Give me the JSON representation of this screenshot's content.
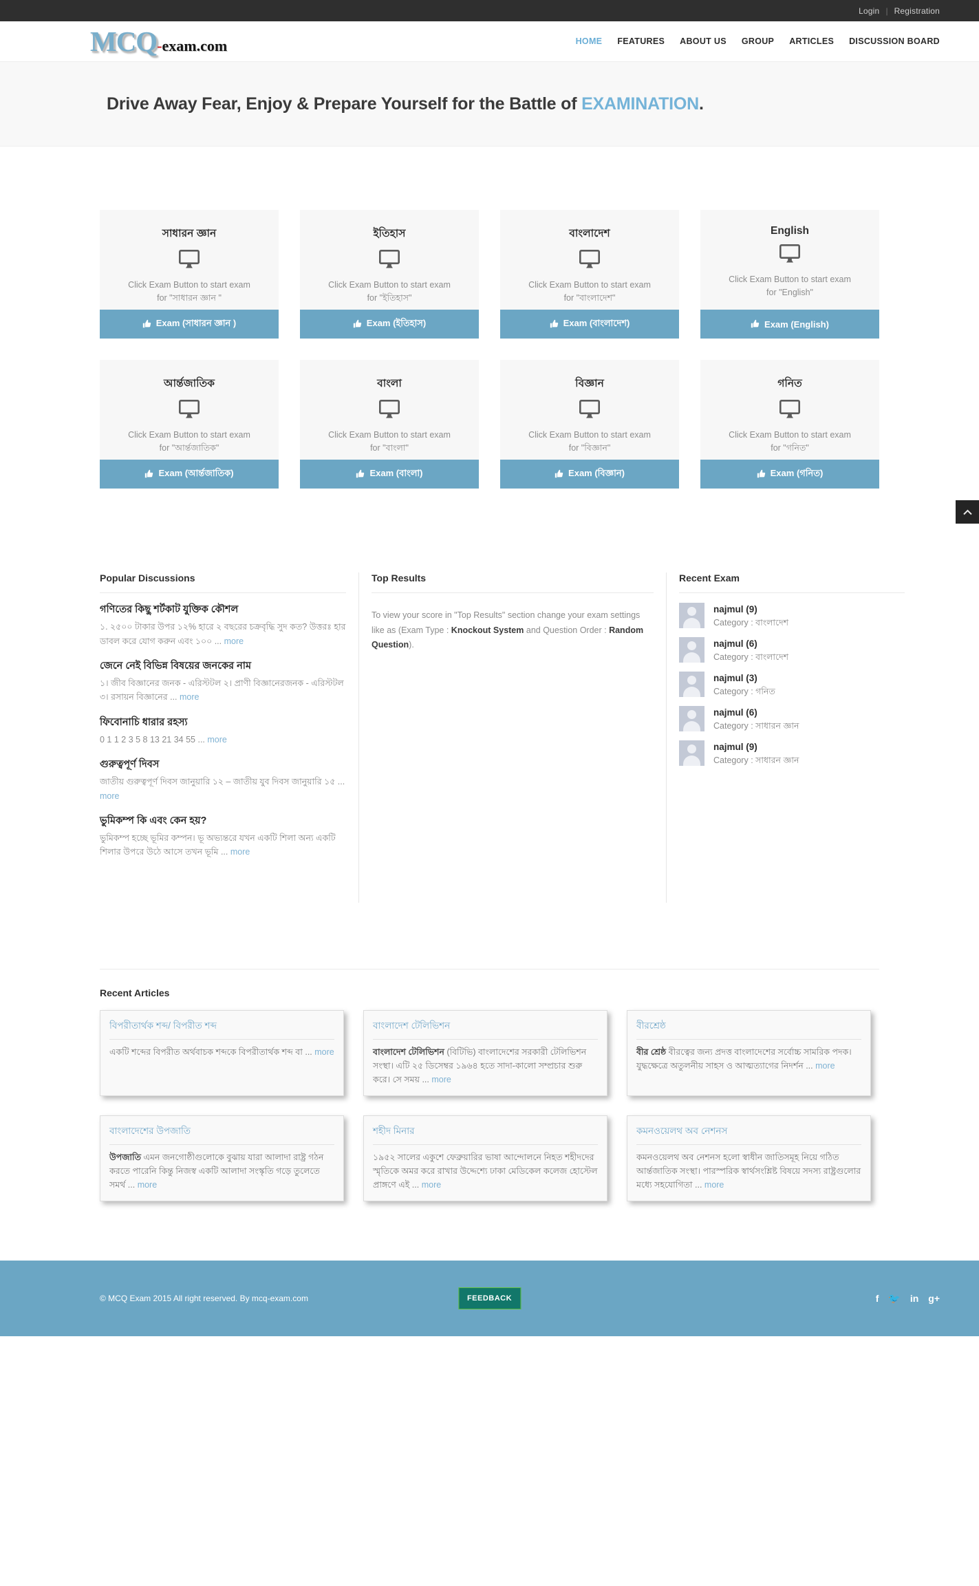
{
  "topbar": {
    "login": "Login",
    "separator": "|",
    "registration": "Registration"
  },
  "logo": {
    "mcq": "MCQ",
    "dash": "-",
    "exam": "exam.com"
  },
  "nav": [
    {
      "label": "HOME",
      "active": true
    },
    {
      "label": "FEATURES",
      "active": false
    },
    {
      "label": "ABOUT US",
      "active": false
    },
    {
      "label": "GROUP",
      "active": false
    },
    {
      "label": "ARTICLES",
      "active": false
    },
    {
      "label": "DISCUSSION BOARD",
      "active": false
    }
  ],
  "hero": {
    "lead": "Drive Away Fear, Enjoy & Prepare Yourself for the Battle of ",
    "highlight": "EXAMINATION",
    "period": "."
  },
  "exam_cards": [
    {
      "title": "সাধারন জ্ঞান",
      "desc_line1": "Click Exam Button to start exam",
      "desc_line2": "for \"সাধারন জ্ঞান \"",
      "button": "Exam (সাধারন জ্ঞান )",
      "icon": "monitor-icon"
    },
    {
      "title": "ইতিহাস",
      "desc_line1": "Click Exam Button to start exam",
      "desc_line2": "for \"ইতিহাস\"",
      "button": "Exam (ইতিহাস)",
      "icon": "monitor-icon"
    },
    {
      "title": "বাংলাদেশ",
      "desc_line1": "Click Exam Button to start exam",
      "desc_line2": "for \"বাংলাদেশ\"",
      "button": "Exam (বাংলাদেশ)",
      "icon": "monitor-icon"
    },
    {
      "title": "English",
      "desc_line1": "Click Exam Button to start exam",
      "desc_line2": "for \"English\"",
      "button": "Exam (English)",
      "icon": "monitor-icon"
    },
    {
      "title": "আর্ন্তজাতিক",
      "desc_line1": "Click Exam Button to start exam",
      "desc_line2": "for \"আর্ন্তজাতিক\"",
      "button": "Exam (আর্ন্তজাতিক)",
      "icon": "monitor-icon"
    },
    {
      "title": "বাংলা",
      "desc_line1": "Click Exam Button to start exam",
      "desc_line2": "for \"বাংলা\"",
      "button": "Exam (বাংলা)",
      "icon": "monitor-icon"
    },
    {
      "title": "বিজ্ঞান",
      "desc_line1": "Click Exam Button to start exam",
      "desc_line2": "for \"বিজ্ঞান\"",
      "button": "Exam (বিজ্ঞান)",
      "icon": "monitor-icon"
    },
    {
      "title": "গনিত",
      "desc_line1": "Click Exam Button to start exam",
      "desc_line2": "for \"গনিত\"",
      "button": "Exam (গনিত)",
      "icon": "monitor-icon"
    }
  ],
  "popular_discussions": {
    "heading": "Popular Discussions",
    "items": [
      {
        "title": "গণিতের কিছু শর্টকাট যুক্তিক কৌশল",
        "text": "১. ২৫০০ টাকার উপর ১২% হারে ২ বছরের চক্রবৃদ্ধি সুদ কত? উত্তরঃ হার ডাবল করে যোগ করুন এবং ১০০ ",
        "more": "more"
      },
      {
        "title": "জেনে নেই বিভিন্ন বিষয়ের জনকের নাম",
        "text": "১। জীব বিজ্ঞানের জনক - এরিস্টটল ২। প্রাণী বিজ্ঞানেরজনক - এরিস্টটল ৩। রসায়ন বিজ্ঞানের ",
        "more": "more"
      },
      {
        "title": "ফিবোনাচি ধারার রহস্য",
        "text": "0  1  1  2  3  5  8  13  21  34  55 ",
        "more": "more"
      },
      {
        "title": "গুরুত্বপূর্ণ দিবস",
        "text": "জাতীয় গুরুত্বপূর্ণ দিবস   জানুয়ারি ১২ – জাতীয় যুব দিবস জানুয়ারি ১৫ ",
        "more": "more"
      },
      {
        "title": "ভুমিকম্প কি এবং কেন হয়?",
        "text": "ভুমিকম্প হচ্ছে ভূমির কম্পন। ভূ অভ্যন্তরে যখন একটি শিলা অন্য একটি শিলার উপরে উঠে আসে তখন ভূমি ",
        "more": "more"
      }
    ]
  },
  "top_results": {
    "heading": "Top Results",
    "part1": "To view your score in \"Top Results\" section change your exam settings like as (Exam Type : ",
    "bold1": "Knockout System",
    "part2": " and Question Order : ",
    "bold2": "Random Question",
    "part3": ")."
  },
  "recent_exam": {
    "heading": "Recent Exam",
    "category_label": "Category : ",
    "items": [
      {
        "name": "najmul (9)",
        "category": "বাংলাদেশ"
      },
      {
        "name": "najmul (6)",
        "category": "বাংলাদেশ"
      },
      {
        "name": "najmul (3)",
        "category": "গনিত"
      },
      {
        "name": "najmul (6)",
        "category": "সাধারন জ্ঞান"
      },
      {
        "name": "najmul (9)",
        "category": "সাধারন জ্ঞান"
      }
    ]
  },
  "recent_articles": {
    "heading": "Recent Articles",
    "items": [
      {
        "title": "বিপরীতার্থক শব্দ/ বিপরীত শব্দ",
        "lead": "",
        "text": "একটি শব্দের বিপরীত অর্থবাচক শব্দকে বিপরীতার্থক শব্দ বা ",
        "more": "more"
      },
      {
        "title": "বাংলাদেশ টেলিভিশন",
        "lead": "বাংলাদেশ টেলিভিশন",
        "text": " (বিটিভি) বাংলাদেশের সরকারী টেলিভিশন সংস্থা।  এটি ২৫ ডিসেম্বর ১৯৬৪ হতে সাদা-কালো সম্প্রচার শুরু করে। সে সময় ",
        "more": "more"
      },
      {
        "title": "বীরশ্রেষ্ঠ",
        "lead": "বীর শ্রেষ্ঠ",
        "text": " বীরত্বের জন্য প্রদত্ত বাংলাদেশের সর্বোচ্চ সামরিক পদক। যুদ্ধক্ষেত্রে অতুলনীয় সাহস ও আত্মত্যাগের নিদর্শন ",
        "more": "more"
      },
      {
        "title": "বাংলাদেশের উপজাতি",
        "lead": "উপজাতি",
        "text": " এমন জনগোষ্ঠীগুলোকে বুঝায় যারা আলাদা রাষ্ট্র গঠন করতে পারেনি কিন্তু নিজস্ব একটি আলাদা সংস্কৃতি গড়ে তুলেতে সমর্থ ",
        "more": "more"
      },
      {
        "title": "শহীদ মিনার",
        "lead": "",
        "text": "১৯৫২ সালের  একুশে ফেব্রুয়ারির ভাষা আন্দোলনে নিহত শহীদদের স্মৃতিকে অমর করে রাখার উদ্দেশ্যে ঢাকা মেডিকেল কলেজ হোস্টেল প্রাঙ্গণে এই ",
        "more": "more"
      },
      {
        "title": "কমনওয়েলথ অব নেশনস",
        "lead": "",
        "text": "কমনওয়েলথ অব নেশনস হলো স্বাধীন জাতিসমূহ নিয়ে গঠিত আর্ন্তজাতিক সংস্থা।  পারস্পরিক স্বার্থসংশ্লিষ্ট বিষয়ে সদস্য রাষ্ট্রগুলোর মধ্যে সহযোগিতা ",
        "more": "more"
      }
    ]
  },
  "footer": {
    "copyright": "© MCQ Exam 2015 All right reserved. By mcq-exam.com",
    "feedback": "FEEDBACK",
    "socials": [
      {
        "name": "facebook-icon",
        "glyph": "f"
      },
      {
        "name": "twitter-icon",
        "glyph": "🐦"
      },
      {
        "name": "linkedin-icon",
        "glyph": "in"
      },
      {
        "name": "googleplus-icon",
        "glyph": "g+"
      }
    ]
  },
  "scroll_top": {
    "icon": "chevron-up-icon"
  },
  "colors": {
    "accent": "#6ba6c4",
    "topbar": "#2f2f2f",
    "hero_highlight": "#74b3d8",
    "link": "#7fb2d3",
    "feedback_bg": "#12776a"
  }
}
